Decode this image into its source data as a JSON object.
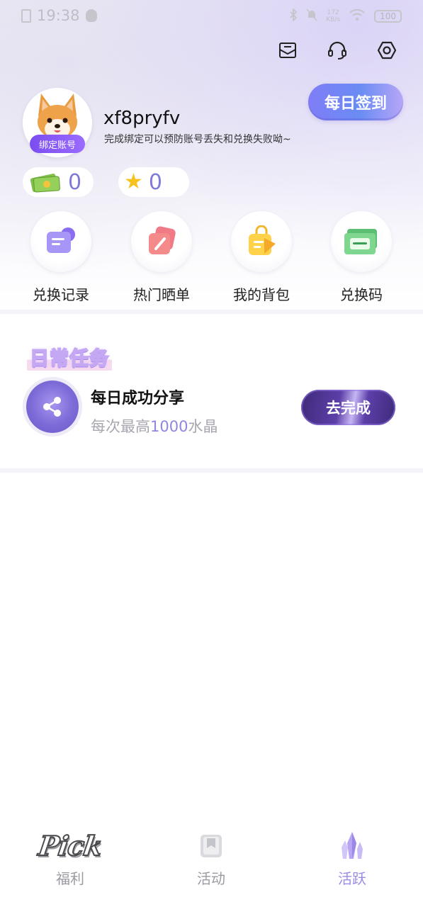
{
  "status_bar": {
    "time": "19:38",
    "net_speed_value": "172",
    "net_speed_unit": "KB/s",
    "battery": "100"
  },
  "header": {
    "icons": [
      "mail-icon",
      "headset-icon",
      "settings-icon"
    ]
  },
  "profile": {
    "bind_badge": "绑定账号",
    "username": "xf8pryfv",
    "tip": "完成绑定可以预防账号丢失和兑换失败呦~",
    "checkin_label": "每日签到"
  },
  "currency": {
    "money": "0",
    "stars": "0"
  },
  "quick_menu": [
    {
      "label": "兑换记录",
      "icon": "exchange-record-icon"
    },
    {
      "label": "热门晒单",
      "icon": "hot-share-icon"
    },
    {
      "label": "我的背包",
      "icon": "backpack-icon"
    },
    {
      "label": "兑换码",
      "icon": "redeem-code-icon"
    }
  ],
  "daily_tasks": {
    "title": "日常任务",
    "items": [
      {
        "title": "每日成功分享",
        "desc_prefix": "每次最高",
        "desc_amount": "1000",
        "desc_suffix": "水晶",
        "button": "去完成"
      }
    ]
  },
  "bottom_nav": {
    "items": [
      {
        "label": "福利",
        "logo_text": "Pick"
      },
      {
        "label": "活动"
      },
      {
        "label": "活跃"
      }
    ],
    "active": "活跃"
  },
  "colors": {
    "accent": "#7f7ad8",
    "active_nav": "#9b8be8",
    "badge": "#7b4df0"
  }
}
